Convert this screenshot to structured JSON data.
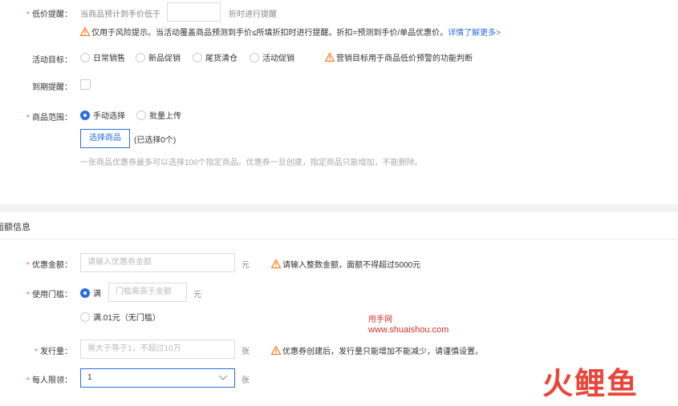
{
  "low_price": {
    "label": "低价提醒：",
    "prefix": "当商品预计到手价低于",
    "input_value": "",
    "suffix": "折时进行提醒",
    "warning": "仅用于风险提示。当活动覆盖商品预测到手价≤所填折扣时进行提醒。折扣=预测到手价/单品优惠价。",
    "link": "详情了解更多>"
  },
  "activity_goal": {
    "label": "活动目标：",
    "options": [
      "日常销售",
      "新品促销",
      "尾货清仓",
      "活动促销"
    ],
    "warning": "营销目标用于商品低价预警的功能判断"
  },
  "expiry": {
    "label": "到期提醒："
  },
  "product_scope": {
    "label": "商品范围：",
    "options": [
      "手动选择",
      "批量上传"
    ],
    "select_button": "选择商品",
    "selected_count": "(已选择0个)",
    "hint": "一张商品优惠券最多可以选择100个指定商品。优惠券一旦创建，指定商品只能增加，不能删除。"
  },
  "section_title": "面额信息",
  "amount": {
    "label": "优惠金额：",
    "placeholder": "请输入优惠券金额",
    "unit": "元",
    "warning": "请输入整数金额，面额不得超过5000元"
  },
  "threshold": {
    "label": "使用门槛：",
    "option_full": "满",
    "placeholder": "门槛需高于金额",
    "unit": "元",
    "option_none": "满.01元（无门槛）"
  },
  "quantity": {
    "label": "发行量：",
    "placeholder": "需大于等于1，不超过10万",
    "unit": "张",
    "warning": "优惠券创建后，发行量只能增加不能减少，请谨慎设置。"
  },
  "limit": {
    "label": "每人限领：",
    "value": "1",
    "unit": "张"
  },
  "watermark": {
    "site_name": "甩手网",
    "site_url": "www.shuaishou.com",
    "logo_text": "火鲤鱼"
  },
  "colors": {
    "accent": "#2a6ee0",
    "required": "#ff4d4f",
    "warning": "#ff7a1a"
  }
}
